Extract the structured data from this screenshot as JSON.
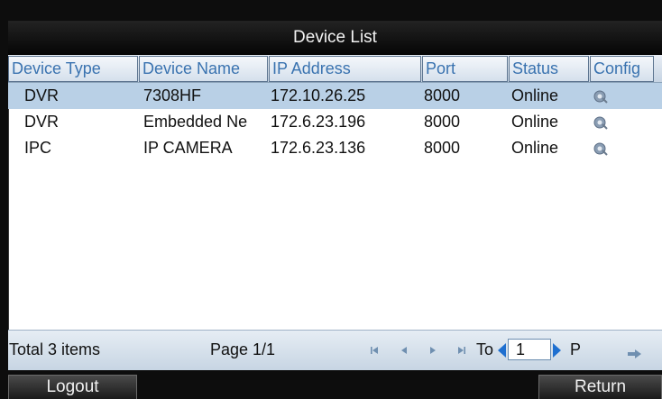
{
  "window": {
    "title": "Device List"
  },
  "table": {
    "columns": [
      "Device Type",
      "Device Name",
      "IP Address",
      "Port",
      "Status",
      "Config"
    ],
    "rows": [
      {
        "type": "DVR",
        "name": "7308HF",
        "ip": "172.10.26.25",
        "port": "8000",
        "status": "Online",
        "config_icon": "config-gear-icon",
        "selected": true
      },
      {
        "type": "DVR",
        "name": "Embedded Ne",
        "ip": "172.6.23.196",
        "port": "8000",
        "status": "Online",
        "config_icon": "config-gear-icon",
        "selected": false
      },
      {
        "type": "IPC",
        "name": "IP CAMERA",
        "ip": "172.6.23.136",
        "port": "8000",
        "status": "Online",
        "config_icon": "config-gear-icon",
        "selected": false
      }
    ]
  },
  "pager": {
    "total": "Total 3 items",
    "page": "Page 1/1",
    "to_label": "To",
    "page_value": "1",
    "p_label": "P",
    "icons": [
      "first-page-icon",
      "prev-page-icon",
      "next-page-icon",
      "last-page-icon",
      "go-arrow-icon"
    ]
  },
  "buttons": {
    "logout": "Logout",
    "return": "Return"
  },
  "colors": {
    "accent": "#1e6fd0",
    "header_text": "#3a73b0",
    "selected_row": "#b9d0e6"
  }
}
